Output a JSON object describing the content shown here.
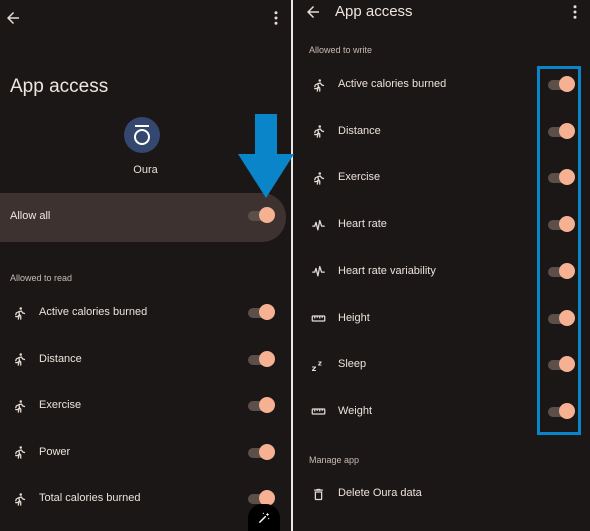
{
  "left": {
    "title": "App access",
    "app_name": "Oura",
    "allow_all_label": "Allow all",
    "allow_all_on": true,
    "section_read": "Allowed to read",
    "read_items": [
      {
        "label": "Active calories burned",
        "icon": "running-icon",
        "on": true
      },
      {
        "label": "Distance",
        "icon": "running-icon",
        "on": true
      },
      {
        "label": "Exercise",
        "icon": "running-icon",
        "on": true
      },
      {
        "label": "Power",
        "icon": "running-icon",
        "on": true
      },
      {
        "label": "Total calories burned",
        "icon": "running-icon",
        "on": true
      }
    ]
  },
  "right": {
    "title": "App access",
    "section_write": "Allowed to write",
    "write_items": [
      {
        "label": "Active calories burned",
        "icon": "running-icon",
        "on": true
      },
      {
        "label": "Distance",
        "icon": "running-icon",
        "on": true
      },
      {
        "label": "Exercise",
        "icon": "running-icon",
        "on": true
      },
      {
        "label": "Heart rate",
        "icon": "heartbeat-icon",
        "on": true
      },
      {
        "label": "Heart rate variability",
        "icon": "heartbeat-icon",
        "on": true
      },
      {
        "label": "Height",
        "icon": "ruler-icon",
        "on": true
      },
      {
        "label": "Sleep",
        "icon": "sleep-icon",
        "on": true
      },
      {
        "label": "Weight",
        "icon": "ruler-icon",
        "on": true
      }
    ],
    "section_manage": "Manage app",
    "delete_label": "Delete Oura data"
  },
  "colors": {
    "background": "#1b1716",
    "toggle_thumb": "#f5b192",
    "toggle_track": "#5c4f4a",
    "card": "#3d3230",
    "annotation_blue": "#0a85c9",
    "app_logo": "#34476e"
  }
}
